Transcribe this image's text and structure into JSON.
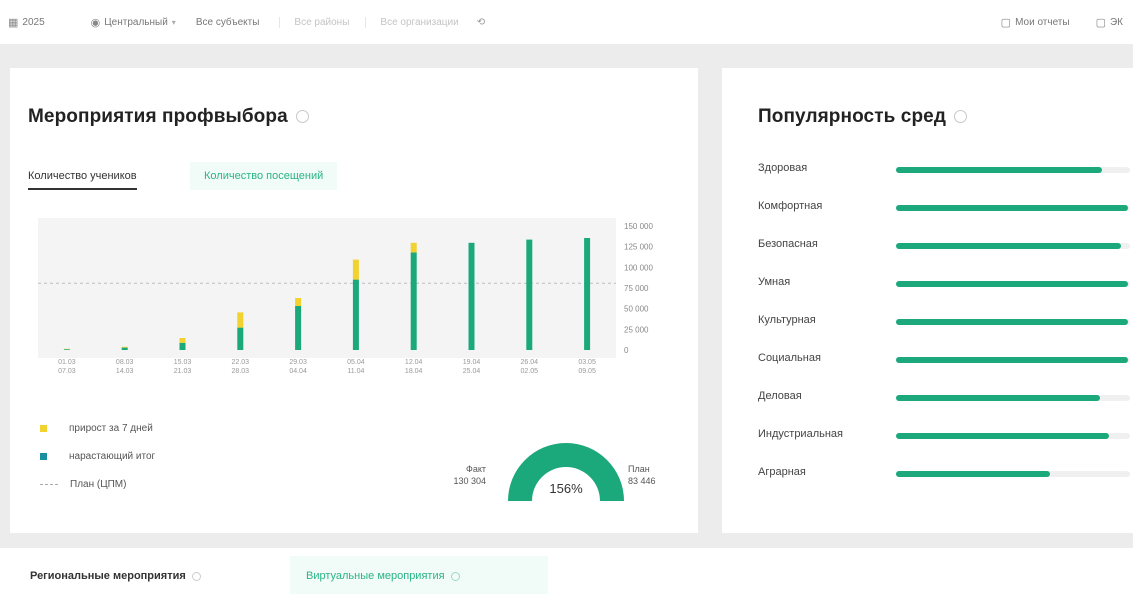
{
  "filters": {
    "year": "2025",
    "district": "Центральный",
    "subjects": "Все субъекты",
    "field3": "Все районы",
    "field4": "Все организации",
    "reset_icon": "reset-icon",
    "right1": "Мои отчеты",
    "right2": "ЭК"
  },
  "left_panel": {
    "title": "Мероприятия профвыбора",
    "tab_active": "Количество учеников",
    "tab_inactive": "Количество посещений",
    "legend": {
      "item1": "прирост за 7 дней",
      "item2": "нарастающий итог",
      "item3": "План (ЦПМ)"
    },
    "gauge": {
      "fact_label": "Факт",
      "fact_value": "130 304",
      "plan_label": "План",
      "plan_value": "83 446",
      "percent_text": "156%",
      "percent": 1.0
    }
  },
  "chart_data": {
    "type": "bar",
    "categories": [
      "01.03\n07.03",
      "08.03\n14.03",
      "15.03\n21.03",
      "22.03\n28.03",
      "29.03\n04.04",
      "05.04\n11.04",
      "12.04\n18.04",
      "19.04\n25.04",
      "26.04\n02.05",
      "03.05\n09.05"
    ],
    "series": [
      {
        "name": "нарастающий итог",
        "values": [
          1000,
          3000,
          9000,
          28000,
          55000,
          88000,
          122000,
          134000,
          138000,
          140000
        ],
        "color": "#1ba97b"
      },
      {
        "name": "прирост за 7 дней",
        "values": [
          500,
          1000,
          6000,
          19000,
          10000,
          25000,
          12000,
          0,
          0,
          0
        ],
        "color": "#f2d22e"
      }
    ],
    "plan_value": 83446,
    "yticks": [
      "150 000",
      "125 000",
      "100 000",
      "75 000",
      "50 000",
      "25 000",
      "0"
    ],
    "ylim": [
      0,
      155000
    ]
  },
  "right_panel": {
    "title": "Популярность сред",
    "items": [
      {
        "label": "Здоровая",
        "value": 0.88
      },
      {
        "label": "Комфортная",
        "value": 0.99
      },
      {
        "label": "Безопасная",
        "value": 0.96
      },
      {
        "label": "Умная",
        "value": 0.99
      },
      {
        "label": "Культурная",
        "value": 0.99
      },
      {
        "label": "Социальная",
        "value": 0.99
      },
      {
        "label": "Деловая",
        "value": 0.87
      },
      {
        "label": "Индустриальная",
        "value": 0.91
      },
      {
        "label": "Аграрная",
        "value": 0.66
      }
    ]
  },
  "bottom_tabs": {
    "tab1": "Региональные мероприятия",
    "tab2": "Виртуальные мероприятия"
  },
  "colors": {
    "green": "#1ba97b",
    "yellow": "#f2d22e",
    "teal": "#1b8ea0"
  }
}
